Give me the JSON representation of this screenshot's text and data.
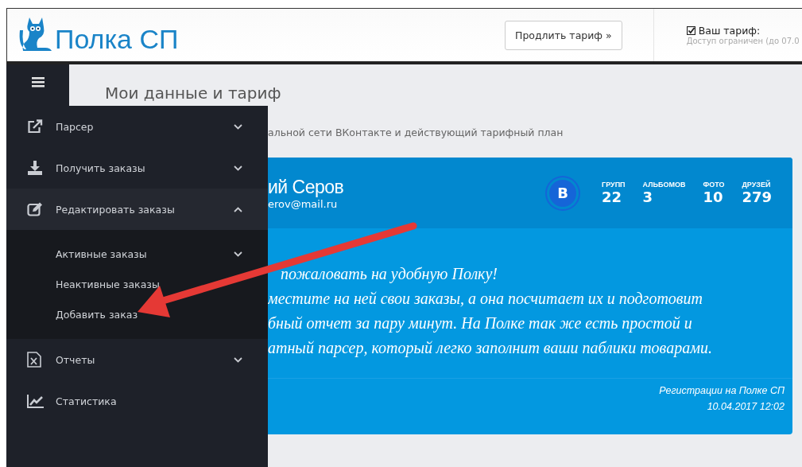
{
  "header": {
    "logo_text": "Полка СП",
    "extend_button": "Продлить тариф »",
    "tariff": {
      "label": "Ваш тариф:",
      "checked": true,
      "note": "Доступ ограничен (до 07.0"
    }
  },
  "page": {
    "title": "Мои данные и тариф",
    "subtitle": "альной сети ВКонтакте и действующий тарифный план"
  },
  "profile": {
    "name": "ий Серов",
    "email": "erov@mail.ru",
    "network_badge": "B",
    "stats": [
      {
        "label": "ГРУПП",
        "value": "22"
      },
      {
        "label": "АЛЬБОМОВ",
        "value": "3"
      },
      {
        "label": "ФОТО",
        "value": "10"
      },
      {
        "label": "ДРУЗЕЙ",
        "value": "279"
      }
    ],
    "welcome_lines": [
      "пожаловать на удобную Полку!",
      "местите на ней свои заказы, а она посчитает их и подготовит",
      "бный отчет за пару минут. На Полке так же есть простой и",
      "атный парсер, который легко заполнит ваши паблики товарами."
    ],
    "registration_label": "Регистрации на Полке СП",
    "registration_date": "10.04.2017 12:02"
  },
  "menu": [
    {
      "label": "Парсер",
      "expanded": false
    },
    {
      "label": "Получить заказы",
      "expanded": false
    },
    {
      "label": "Редактировать заказы",
      "expanded": true,
      "children": [
        {
          "label": "Активные заказы",
          "expanded": false
        },
        {
          "label": "Неактивные заказы"
        },
        {
          "label": "Добавить заказ"
        }
      ]
    },
    {
      "label": "Отчеты",
      "expanded": false
    },
    {
      "label": "Статистика"
    }
  ]
}
